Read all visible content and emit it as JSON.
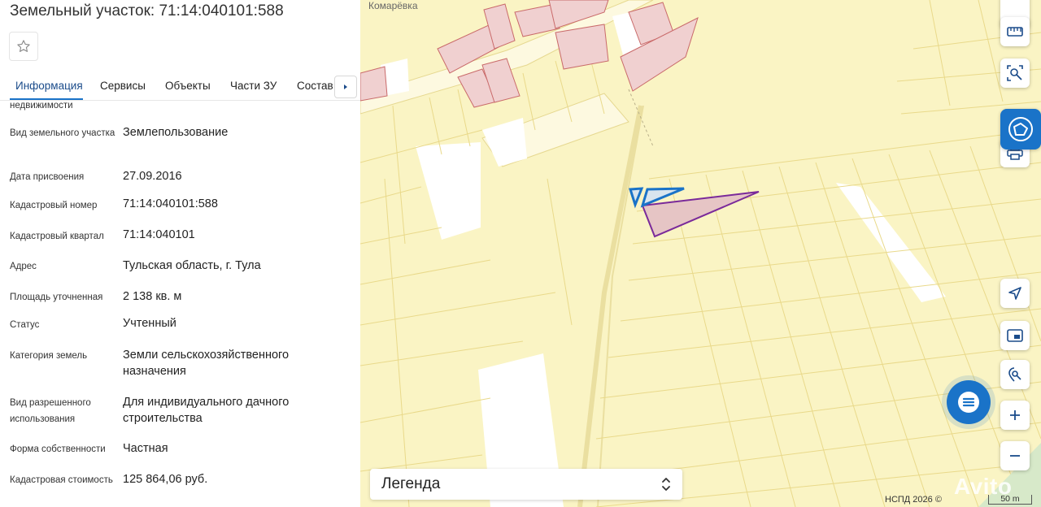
{
  "panel": {
    "title": "Земельный участок: 71:14:040101:588",
    "tabs": [
      "Информация",
      "Сервисы",
      "Объекты",
      "Части ЗУ",
      "Состав"
    ],
    "partial_label": "недвижимости",
    "rows": [
      {
        "label": "Вид земельного участка",
        "value": "Землепользование"
      },
      {
        "label": "Дата присвоения",
        "value": "27.09.2016"
      },
      {
        "label": "Кадастровый номер",
        "value": "71:14:040101:588"
      },
      {
        "label": "Кадастровый квартал",
        "value": "71:14:040101"
      },
      {
        "label": "Адрес",
        "value": "Тульская область, г. Тула"
      },
      {
        "label": "Площадь уточненная",
        "value": "2 138 кв. м"
      },
      {
        "label": "Статус",
        "value": "Учтенный"
      },
      {
        "label": "Категория земель",
        "value": "Земли сельскохозяйственного назначения"
      },
      {
        "label": "Вид разрешенного использования",
        "value": "Для индивидуального дачного строительства"
      },
      {
        "label": "Форма собственности",
        "value": "Частная"
      },
      {
        "label": "Кадастровая стоимость",
        "value": "125 864,06 руб."
      }
    ]
  },
  "map": {
    "place_label": "Комарёвка",
    "legend_label": "Легенда",
    "copyright": "НСПД 2026 ©",
    "scale_label": "50 m",
    "watermark": "Avito",
    "colors": {
      "background": "#faf4c4",
      "parcel_line": "#e9d98a",
      "selected_parcel": "#7a2a9a",
      "accent": "#1a73c8"
    }
  }
}
